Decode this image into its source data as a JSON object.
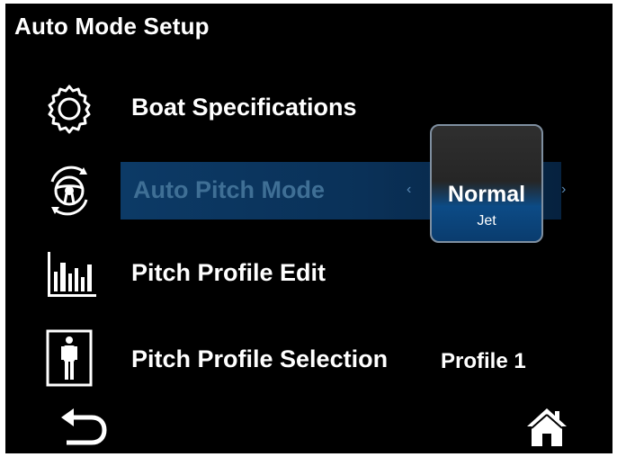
{
  "header": {
    "title": "Auto Mode Setup"
  },
  "menu": {
    "items": [
      {
        "label": "Boat Specifications",
        "icon": "gear-icon"
      },
      {
        "label": "Auto Pitch Mode",
        "icon": "steering-wheel-icon",
        "selected": true
      },
      {
        "label": "Pitch Profile Edit",
        "icon": "bar-chart-icon"
      },
      {
        "label": "Pitch Profile Selection",
        "icon": "person-icon",
        "value": "Profile 1"
      }
    ]
  },
  "popup": {
    "selected_value": "Normal",
    "sub_label": "Jet"
  },
  "footer": {
    "back_icon": "back-arrow-icon",
    "home_icon": "home-icon"
  },
  "colors": {
    "background": "#000000",
    "highlight": "#0c3a66",
    "popup_accent": "#0c4b86",
    "dim_label": "#3f6f95"
  }
}
